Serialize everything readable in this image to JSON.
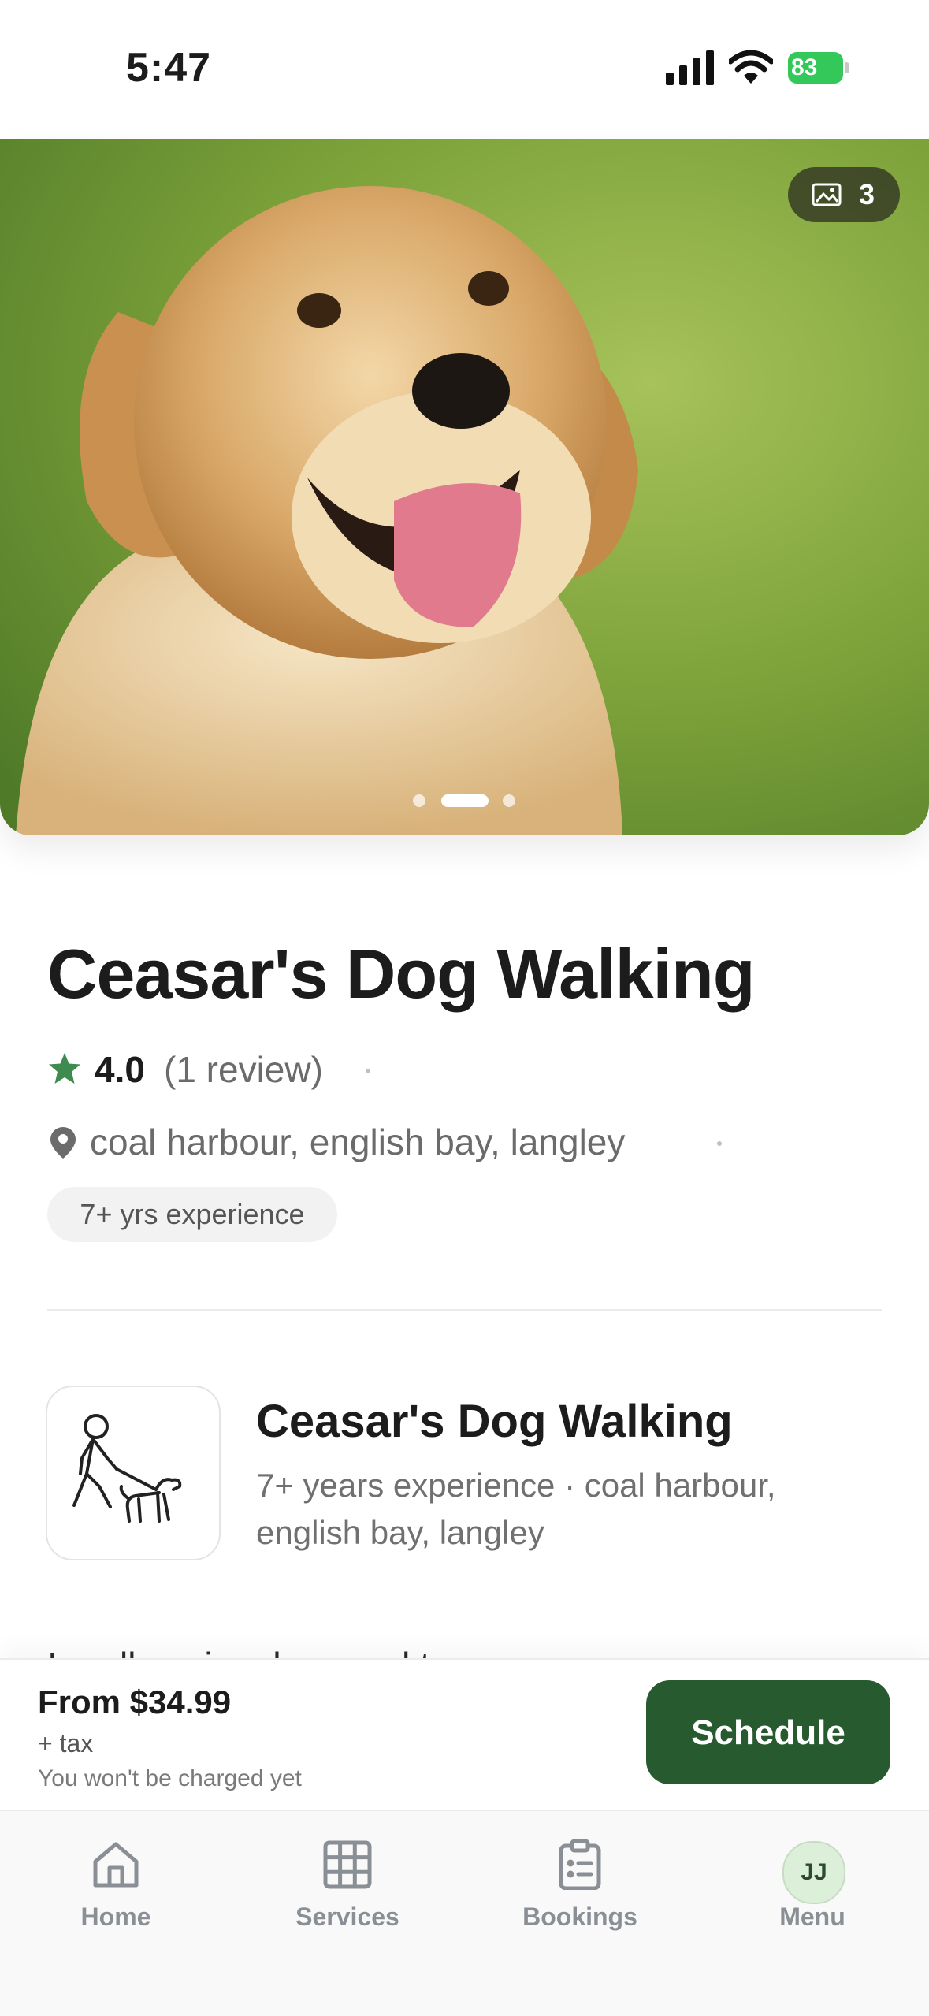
{
  "status_bar": {
    "time": "5:47",
    "battery": "83"
  },
  "hero": {
    "photo_count": "3",
    "active_slide": 2,
    "total_slides": 3
  },
  "listing": {
    "title": "Ceasar's Dog Walking",
    "rating": "4.0",
    "review_count": "(1 review)",
    "locations": "coal harbour, english bay, langley",
    "experience_badge": "7+ yrs experience"
  },
  "provider": {
    "name": "Ceasar's Dog Walking",
    "description": "7+ years experience · coal harbour, english bay, langley",
    "truncated_text": "I really enjoy dogs and to..."
  },
  "booking": {
    "price": "From $34.99",
    "tax": "+ tax",
    "charge_note": "You won't be charged yet",
    "schedule_label": "Schedule"
  },
  "tabs": [
    {
      "label": "Home",
      "icon": "home-icon"
    },
    {
      "label": "Services",
      "icon": "grid-icon"
    },
    {
      "label": "Bookings",
      "icon": "clipboard-icon"
    },
    {
      "label": "Menu",
      "icon": "avatar",
      "initials": "JJ"
    }
  ],
  "colors": {
    "primary": "#275a2e",
    "star": "#3f8a4f",
    "battery": "#34c759"
  }
}
